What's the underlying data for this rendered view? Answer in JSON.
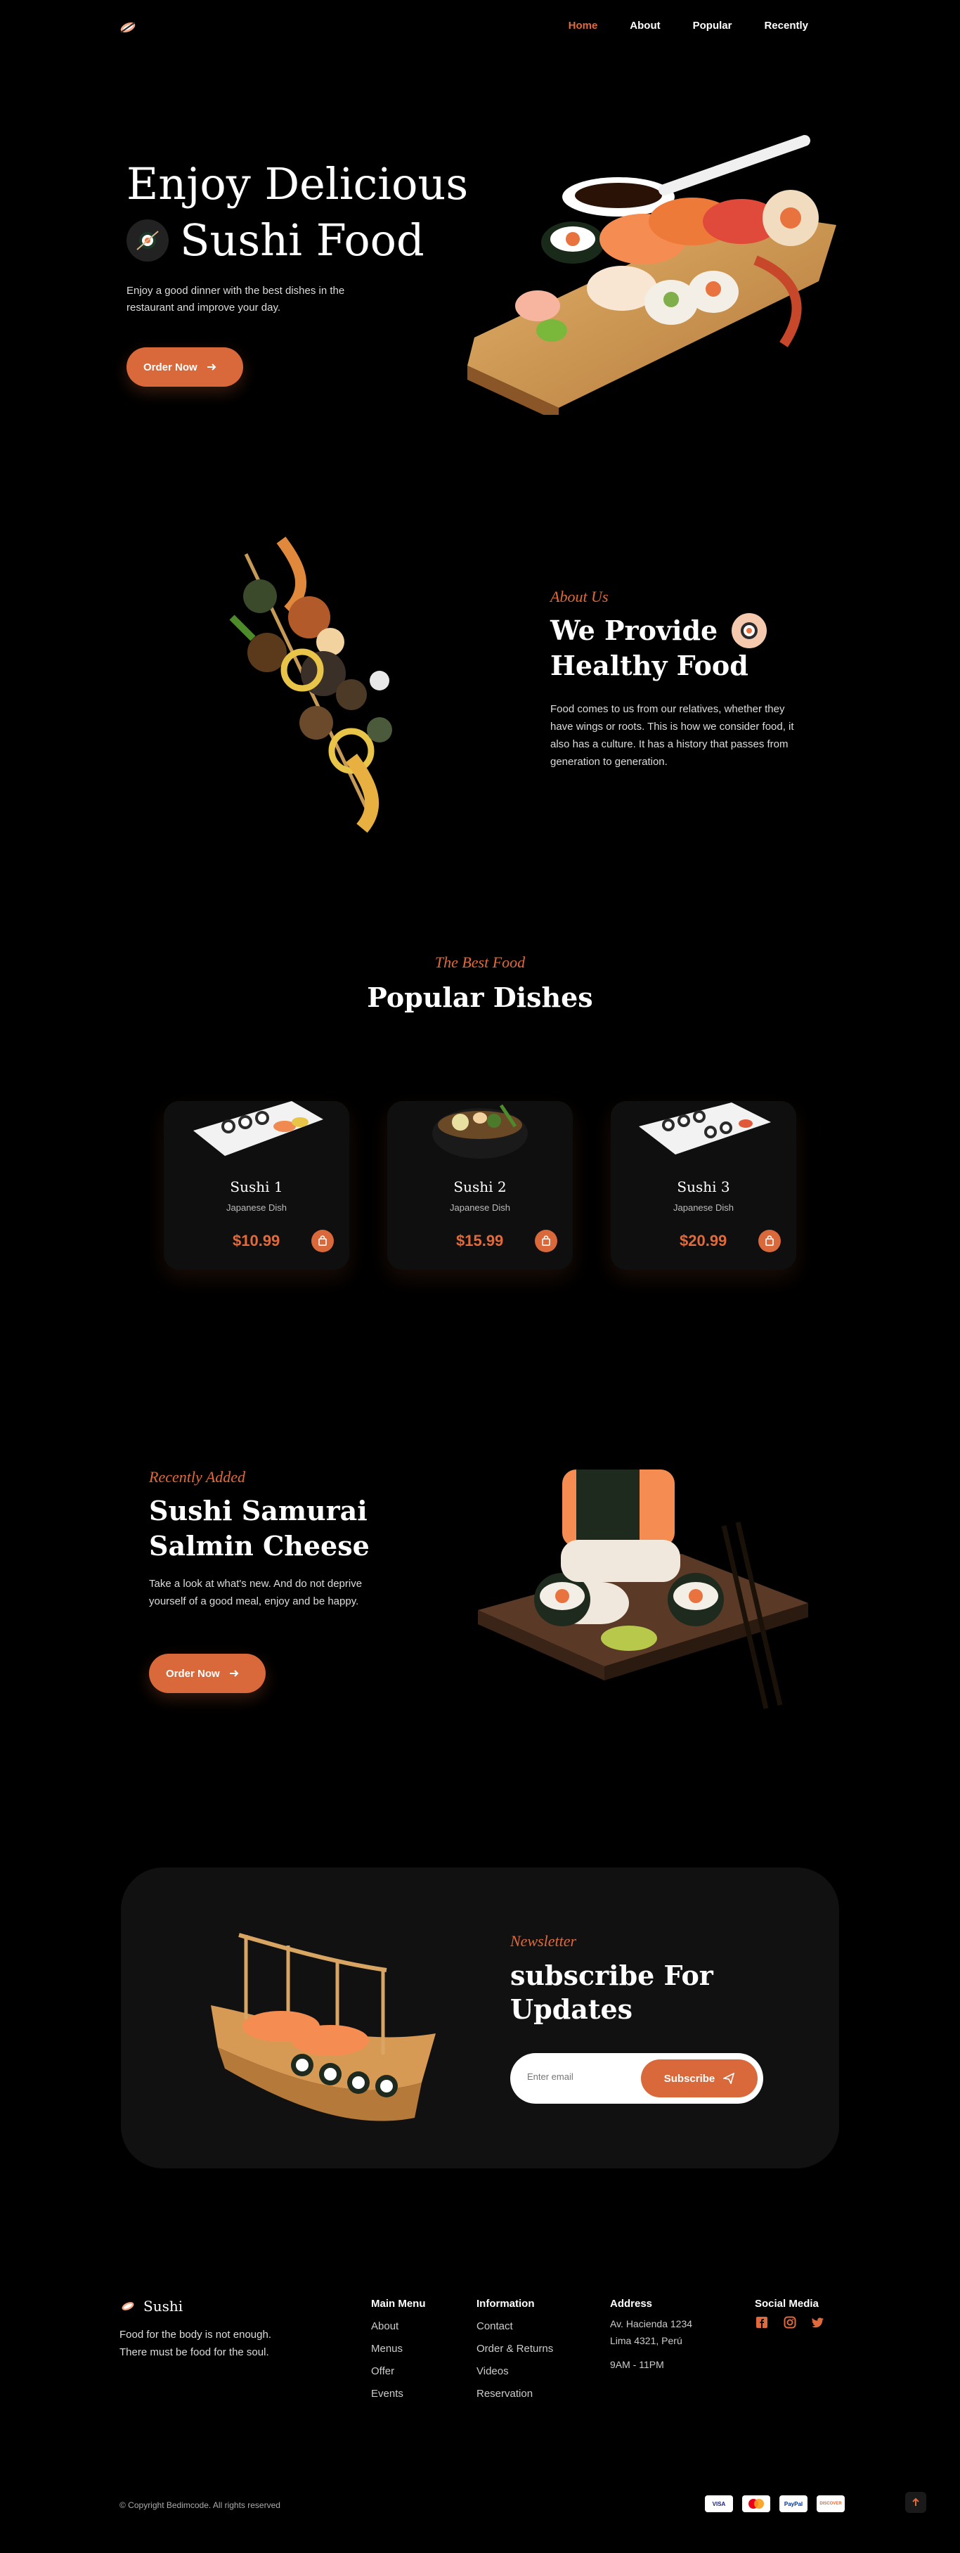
{
  "header": {
    "nav": [
      {
        "label": "Home",
        "active": true
      },
      {
        "label": "About"
      },
      {
        "label": "Popular"
      },
      {
        "label": "Recently"
      }
    ]
  },
  "hero": {
    "title_line1": "Enjoy Delicious",
    "title_line2": "Sushi Food",
    "description": "Enjoy a good dinner with the best dishes in the restaurant and improve your day.",
    "button_label": "Order Now"
  },
  "about": {
    "subtitle": "About Us",
    "title_line1": "We Provide",
    "title_line2": "Healthy Food",
    "description": "Food comes to us from our relatives, whether they have wings or roots. This is how we consider food, it also has a culture. It has a history that passes from generation to generation."
  },
  "popular": {
    "subtitle": "The Best Food",
    "title": "Popular Dishes",
    "cards": [
      {
        "name": "Sushi 1",
        "category": "Japanese Dish",
        "price": "$10.99"
      },
      {
        "name": "Sushi 2",
        "category": "Japanese Dish",
        "price": "$15.99"
      },
      {
        "name": "Sushi 3",
        "category": "Japanese Dish",
        "price": "$20.99"
      }
    ]
  },
  "recently": {
    "subtitle": "Recently Added",
    "title_line1": "Sushi Samurai",
    "title_line2": "Salmin Cheese",
    "description": "Take a look at what's new. And do not deprive yourself of a good meal, enjoy and be happy.",
    "button_label": "Order Now"
  },
  "newsletter": {
    "subtitle": "Newsletter",
    "title_line1": "subscribe For",
    "title_line2": "Updates",
    "placeholder": "Enter email",
    "button_label": "Subscribe"
  },
  "footer": {
    "brand": "Sushi",
    "description": "Food for the body is not enough. There must be food for the soul.",
    "main_menu": {
      "title": "Main Menu",
      "items": [
        "About",
        "Menus",
        "Offer",
        "Events"
      ]
    },
    "information": {
      "title": "Information",
      "items": [
        "Contact",
        "Order & Returns",
        "Videos",
        "Reservation"
      ]
    },
    "address": {
      "title": "Address",
      "line1": "Av. Hacienda 1234",
      "line2": "Lima 4321, Perú",
      "hours": "9AM - 11PM"
    },
    "social": {
      "title": "Social Media",
      "icons": [
        "facebook-icon",
        "instagram-icon",
        "twitter-icon"
      ]
    },
    "copyright": "© Copyright Bedimcode. All rights reserved",
    "payments": [
      "VISA",
      "mastercard",
      "PayPal",
      "DISCOVER"
    ]
  },
  "colors": {
    "accent": "#d9693b",
    "background": "#000000",
    "card": "#0f0f0f",
    "box": "#111111"
  }
}
